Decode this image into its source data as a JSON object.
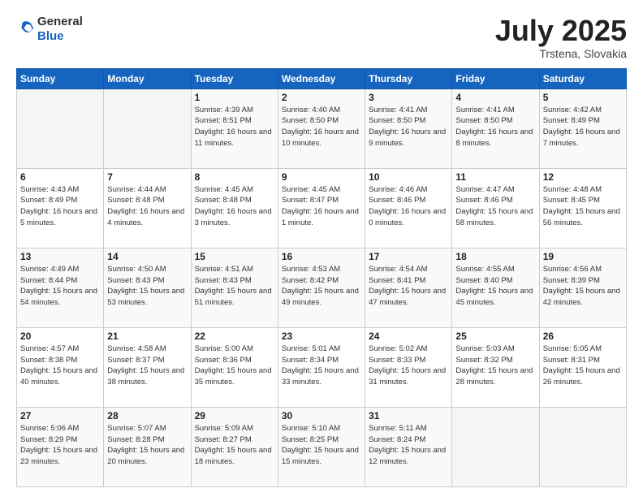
{
  "header": {
    "logo_general": "General",
    "logo_blue": "Blue",
    "month": "July 2025",
    "location": "Trstena, Slovakia"
  },
  "weekdays": [
    "Sunday",
    "Monday",
    "Tuesday",
    "Wednesday",
    "Thursday",
    "Friday",
    "Saturday"
  ],
  "weeks": [
    [
      {
        "day": "",
        "info": ""
      },
      {
        "day": "",
        "info": ""
      },
      {
        "day": "1",
        "info": "Sunrise: 4:39 AM\nSunset: 8:51 PM\nDaylight: 16 hours\nand 11 minutes."
      },
      {
        "day": "2",
        "info": "Sunrise: 4:40 AM\nSunset: 8:50 PM\nDaylight: 16 hours\nand 10 minutes."
      },
      {
        "day": "3",
        "info": "Sunrise: 4:41 AM\nSunset: 8:50 PM\nDaylight: 16 hours\nand 9 minutes."
      },
      {
        "day": "4",
        "info": "Sunrise: 4:41 AM\nSunset: 8:50 PM\nDaylight: 16 hours\nand 8 minutes."
      },
      {
        "day": "5",
        "info": "Sunrise: 4:42 AM\nSunset: 8:49 PM\nDaylight: 16 hours\nand 7 minutes."
      }
    ],
    [
      {
        "day": "6",
        "info": "Sunrise: 4:43 AM\nSunset: 8:49 PM\nDaylight: 16 hours\nand 5 minutes."
      },
      {
        "day": "7",
        "info": "Sunrise: 4:44 AM\nSunset: 8:48 PM\nDaylight: 16 hours\nand 4 minutes."
      },
      {
        "day": "8",
        "info": "Sunrise: 4:45 AM\nSunset: 8:48 PM\nDaylight: 16 hours\nand 3 minutes."
      },
      {
        "day": "9",
        "info": "Sunrise: 4:45 AM\nSunset: 8:47 PM\nDaylight: 16 hours\nand 1 minute."
      },
      {
        "day": "10",
        "info": "Sunrise: 4:46 AM\nSunset: 8:46 PM\nDaylight: 16 hours\nand 0 minutes."
      },
      {
        "day": "11",
        "info": "Sunrise: 4:47 AM\nSunset: 8:46 PM\nDaylight: 15 hours\nand 58 minutes."
      },
      {
        "day": "12",
        "info": "Sunrise: 4:48 AM\nSunset: 8:45 PM\nDaylight: 15 hours\nand 56 minutes."
      }
    ],
    [
      {
        "day": "13",
        "info": "Sunrise: 4:49 AM\nSunset: 8:44 PM\nDaylight: 15 hours\nand 54 minutes."
      },
      {
        "day": "14",
        "info": "Sunrise: 4:50 AM\nSunset: 8:43 PM\nDaylight: 15 hours\nand 53 minutes."
      },
      {
        "day": "15",
        "info": "Sunrise: 4:51 AM\nSunset: 8:43 PM\nDaylight: 15 hours\nand 51 minutes."
      },
      {
        "day": "16",
        "info": "Sunrise: 4:53 AM\nSunset: 8:42 PM\nDaylight: 15 hours\nand 49 minutes."
      },
      {
        "day": "17",
        "info": "Sunrise: 4:54 AM\nSunset: 8:41 PM\nDaylight: 15 hours\nand 47 minutes."
      },
      {
        "day": "18",
        "info": "Sunrise: 4:55 AM\nSunset: 8:40 PM\nDaylight: 15 hours\nand 45 minutes."
      },
      {
        "day": "19",
        "info": "Sunrise: 4:56 AM\nSunset: 8:39 PM\nDaylight: 15 hours\nand 42 minutes."
      }
    ],
    [
      {
        "day": "20",
        "info": "Sunrise: 4:57 AM\nSunset: 8:38 PM\nDaylight: 15 hours\nand 40 minutes."
      },
      {
        "day": "21",
        "info": "Sunrise: 4:58 AM\nSunset: 8:37 PM\nDaylight: 15 hours\nand 38 minutes."
      },
      {
        "day": "22",
        "info": "Sunrise: 5:00 AM\nSunset: 8:36 PM\nDaylight: 15 hours\nand 35 minutes."
      },
      {
        "day": "23",
        "info": "Sunrise: 5:01 AM\nSunset: 8:34 PM\nDaylight: 15 hours\nand 33 minutes."
      },
      {
        "day": "24",
        "info": "Sunrise: 5:02 AM\nSunset: 8:33 PM\nDaylight: 15 hours\nand 31 minutes."
      },
      {
        "day": "25",
        "info": "Sunrise: 5:03 AM\nSunset: 8:32 PM\nDaylight: 15 hours\nand 28 minutes."
      },
      {
        "day": "26",
        "info": "Sunrise: 5:05 AM\nSunset: 8:31 PM\nDaylight: 15 hours\nand 26 minutes."
      }
    ],
    [
      {
        "day": "27",
        "info": "Sunrise: 5:06 AM\nSunset: 8:29 PM\nDaylight: 15 hours\nand 23 minutes."
      },
      {
        "day": "28",
        "info": "Sunrise: 5:07 AM\nSunset: 8:28 PM\nDaylight: 15 hours\nand 20 minutes."
      },
      {
        "day": "29",
        "info": "Sunrise: 5:09 AM\nSunset: 8:27 PM\nDaylight: 15 hours\nand 18 minutes."
      },
      {
        "day": "30",
        "info": "Sunrise: 5:10 AM\nSunset: 8:25 PM\nDaylight: 15 hours\nand 15 minutes."
      },
      {
        "day": "31",
        "info": "Sunrise: 5:11 AM\nSunset: 8:24 PM\nDaylight: 15 hours\nand 12 minutes."
      },
      {
        "day": "",
        "info": ""
      },
      {
        "day": "",
        "info": ""
      }
    ]
  ]
}
